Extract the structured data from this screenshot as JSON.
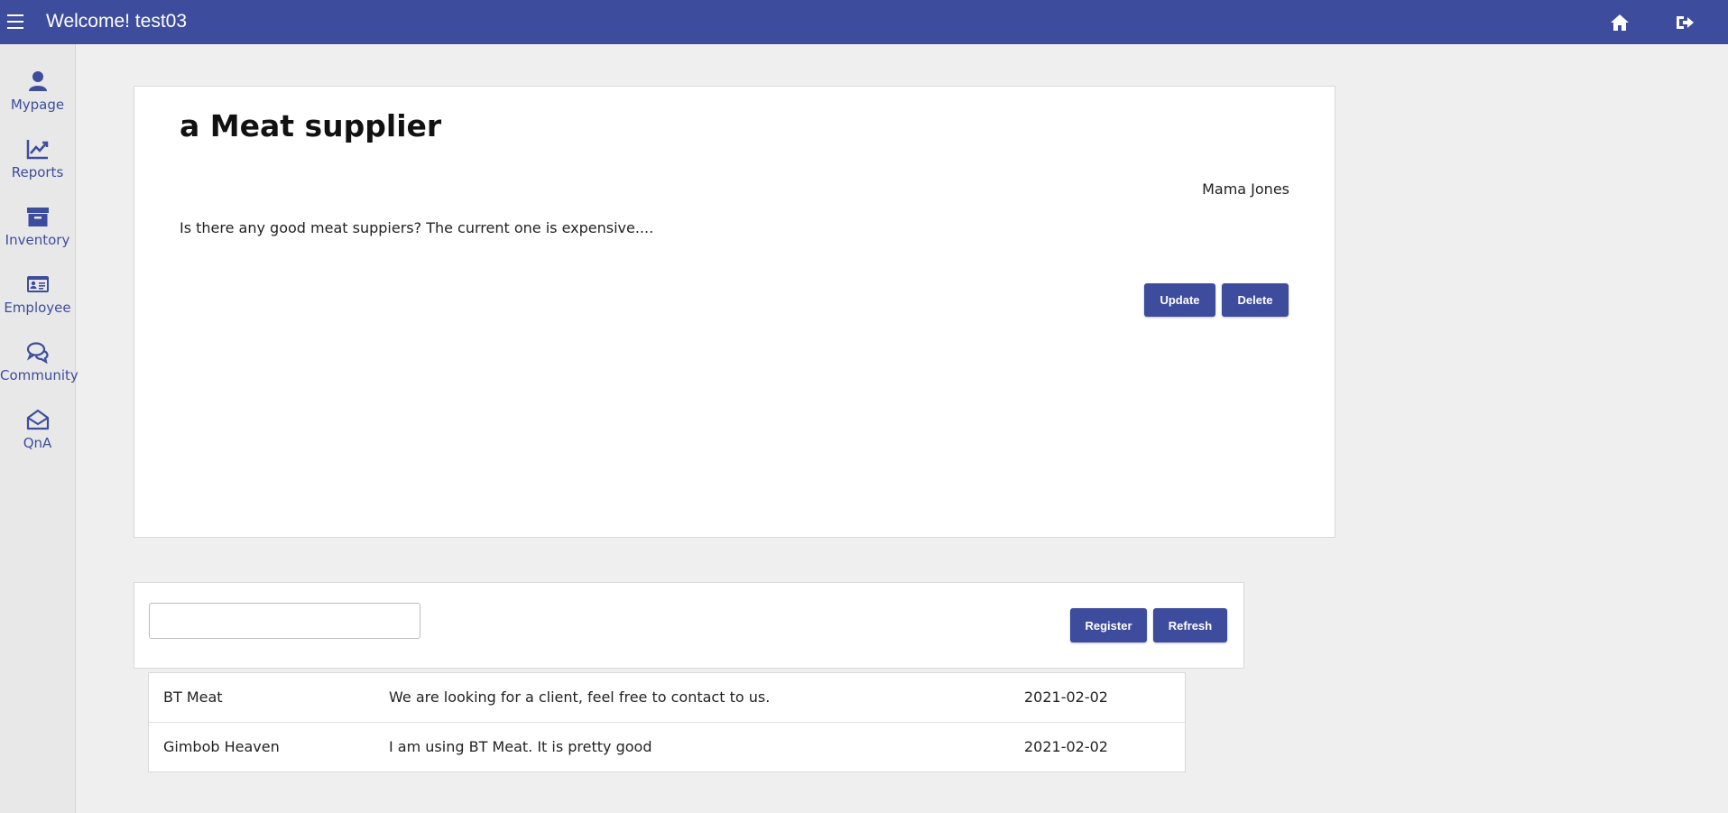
{
  "header": {
    "title": "Welcome! test03",
    "menu_icon": "hamburger-icon",
    "home_icon": "home-icon",
    "logout_icon": "logout-icon",
    "bg_color": "#3e4c9d"
  },
  "sidebar": {
    "items": [
      {
        "label": "Mypage",
        "icon": "user-icon"
      },
      {
        "label": "Reports",
        "icon": "chart-line-icon"
      },
      {
        "label": "Inventory",
        "icon": "archive-box-icon"
      },
      {
        "label": "Employee",
        "icon": "id-card-icon"
      },
      {
        "label": "Community",
        "icon": "chat-bubbles-icon"
      },
      {
        "label": "QnA",
        "icon": "envelope-open-icon"
      }
    ]
  },
  "post": {
    "title": "a Meat supplier",
    "author": "Mama Jones",
    "body": "Is there any good meat suppiers? The current one is expensive....",
    "update_label": "Update",
    "delete_label": "Delete"
  },
  "comment_form": {
    "input_value": "",
    "register_label": "Register",
    "refresh_label": "Refresh"
  },
  "comments": [
    {
      "author": "BT Meat",
      "text": "We are looking for a client, feel free to contact to us.",
      "date": "2021-02-02"
    },
    {
      "author": "Gimbob Heaven",
      "text": "I am using BT Meat. It is pretty good",
      "date": "2021-02-02"
    }
  ]
}
